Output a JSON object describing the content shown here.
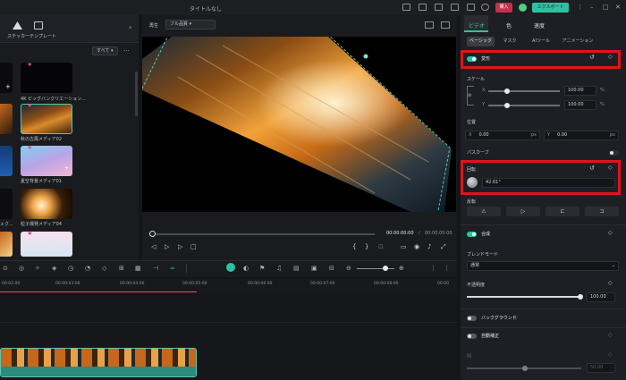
{
  "window": {
    "title": "タイトルなし",
    "purchase_label": "購入",
    "export_label": "エクスポート"
  },
  "left_panel": {
    "tabs": [
      {
        "label": "ステッカー"
      },
      {
        "label": "テンプレート"
      }
    ],
    "filter_selected": "すべて",
    "media_items": [
      {
        "label": "4K ビッグバンクリエーション..."
      },
      {
        "label": "秋の古風メディア02"
      },
      {
        "label": "夏空背景メディア01"
      },
      {
        "label": "粒子爆発メディア04"
      }
    ],
    "left_partial_label": "ェク..."
  },
  "preview": {
    "label": "再生",
    "quality": "フル品質",
    "current_time": "00:00:00:00",
    "total_time": "00:00:05:00"
  },
  "timeline": {
    "ruler_labels": [
      "00:02:00",
      "00:00:03:00",
      "00:00:04:00",
      "00:00:05:00",
      "00:00:06:00",
      "00:00:07:00",
      "00:00:08:00",
      "00:00"
    ]
  },
  "right_panel": {
    "tabs": [
      "ビデオ",
      "色",
      "速度"
    ],
    "subtabs": [
      "ベーシック",
      "マスク",
      "AIツール",
      "アニメーション"
    ],
    "transform_label": "変形",
    "scale_label": "スケール",
    "scale_x_label": "X",
    "scale_y_label": "Y",
    "scale_x_value": "100.00",
    "scale_y_value": "100.00",
    "percent": "%",
    "position_label": "位置",
    "pos_x_label": "X",
    "pos_x_value": "0.00",
    "pos_y_label": "Y",
    "pos_y_value": "0.00",
    "px": "px",
    "path_curve_label": "パスカーブ",
    "rotation_label": "回転",
    "rotation_value": "42.61°",
    "flip_label": "反転",
    "composite_label": "合成",
    "blend_mode_label": "ブレンドモード",
    "blend_mode_value": "通常",
    "opacity_label": "不透明度",
    "opacity_value": "100.00",
    "background_label": "バックグラウンド",
    "auto_correct_label": "自動補正",
    "dim_row_value": "50.00",
    "dim_row_label": "明"
  },
  "colors": {
    "accent": "#2dc1a1",
    "highlight": "#e3121b",
    "purchase": "#c62f4a"
  }
}
